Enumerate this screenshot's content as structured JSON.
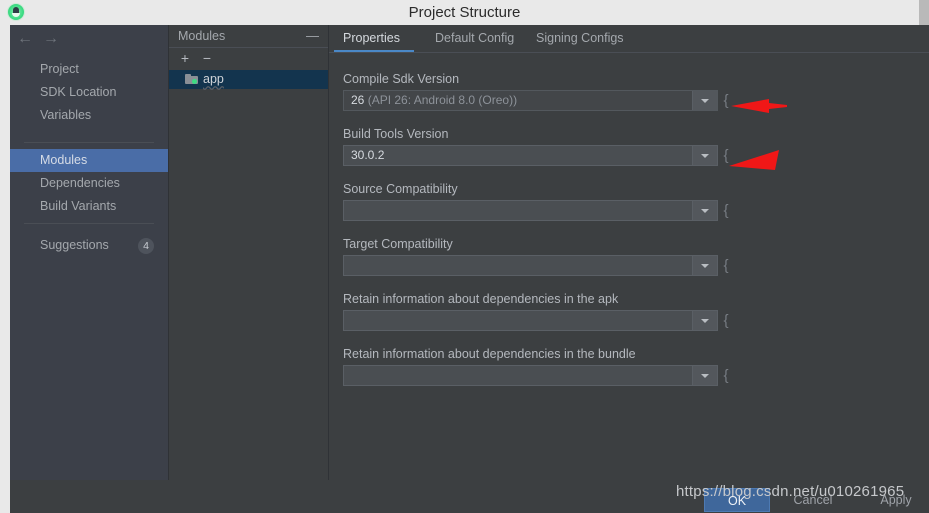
{
  "window": {
    "title": "Project Structure",
    "app_icon": "android-studio-icon"
  },
  "nav": {
    "back_icon": "←",
    "forward_icon": "→"
  },
  "sidebar": {
    "group_top": [
      {
        "label": "Project",
        "selected": false
      },
      {
        "label": "SDK Location",
        "selected": false
      },
      {
        "label": "Variables",
        "selected": false
      }
    ],
    "group_mid": [
      {
        "label": "Modules",
        "selected": true
      },
      {
        "label": "Dependencies",
        "selected": false
      },
      {
        "label": "Build Variants",
        "selected": false
      }
    ],
    "group_bottom": [
      {
        "label": "Suggestions",
        "selected": false,
        "badge": "4"
      }
    ]
  },
  "modules_panel": {
    "title": "Modules",
    "collapse_icon": "—",
    "add_icon": "+",
    "remove_icon": "−",
    "tree": [
      {
        "label": "app",
        "icon": "folder-module-icon",
        "selected": true
      }
    ]
  },
  "content": {
    "tabs": [
      {
        "label": "Properties",
        "active": true
      },
      {
        "label": "Default Config",
        "active": false
      },
      {
        "label": "Signing Configs",
        "active": false
      }
    ],
    "fields": [
      {
        "label": "Compile Sdk Version",
        "value": "26",
        "value_suffix": " (API 26: Android 8.0 (Oreo))",
        "disabled": true,
        "dropdown_icon": "chevron-down-icon",
        "annotated": true
      },
      {
        "label": "Build Tools Version",
        "value": "30.0.2",
        "value_suffix": "",
        "disabled": false,
        "dropdown_icon": "chevron-down-icon",
        "annotated": true
      },
      {
        "label": "Source Compatibility",
        "value": "",
        "value_suffix": "",
        "disabled": false,
        "dropdown_icon": "chevron-down-icon",
        "annotated": false
      },
      {
        "label": "Target Compatibility",
        "value": "",
        "value_suffix": "",
        "disabled": false,
        "dropdown_icon": "chevron-down-icon",
        "annotated": false
      },
      {
        "label": "Retain information about dependencies in the apk",
        "value": "",
        "value_suffix": "",
        "disabled": false,
        "dropdown_icon": "chevron-down-icon",
        "annotated": false
      },
      {
        "label": "Retain information about dependencies in the bundle",
        "value": "",
        "value_suffix": "",
        "disabled": false,
        "dropdown_icon": "chevron-down-icon",
        "annotated": false
      }
    ]
  },
  "footer": {
    "buttons": [
      {
        "label": "OK",
        "primary": true
      },
      {
        "label": "Cancel",
        "primary": false
      },
      {
        "label": "Apply",
        "primary": false
      }
    ]
  },
  "watermark": {
    "text": "https://blog.csdn.net/u010261965"
  },
  "colors": {
    "accent": "#4a88c7",
    "selection": "#4a6da7",
    "tree_selection": "#13344e",
    "panel_bg": "#3c3f41",
    "sidebar_bg": "#3c4049",
    "annotation_red": "#f01717",
    "module_dot_green": "#3ddc84"
  }
}
